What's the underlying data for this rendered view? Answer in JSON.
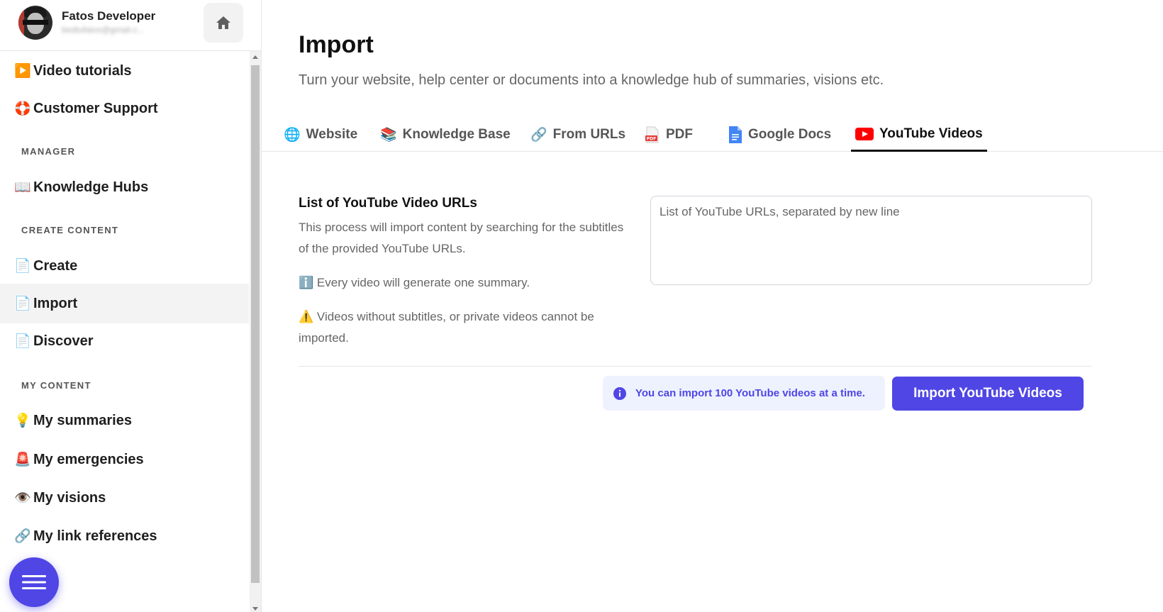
{
  "user": {
    "name": "Fatos Developer",
    "email": "bedtufatos@gmail.c..."
  },
  "icons": {
    "home": "home-icon",
    "menu": "menu-icon",
    "info": "info-icon"
  },
  "sidebar": {
    "items": [
      {
        "label": "Video tutorials",
        "icon": "▶️"
      },
      {
        "label": "Customer Support",
        "icon": "🛟"
      }
    ],
    "sections": [
      {
        "title": "MANAGER",
        "items": [
          {
            "label": "Knowledge Hubs",
            "icon": "📖"
          }
        ]
      },
      {
        "title": "CREATE CONTENT",
        "items": [
          {
            "label": "Create",
            "icon": "📄"
          },
          {
            "label": "Import",
            "icon": "📄",
            "active": true
          },
          {
            "label": "Discover",
            "icon": "📄"
          }
        ]
      },
      {
        "title": "MY CONTENT",
        "items": [
          {
            "label": "My summaries",
            "icon": "💡"
          },
          {
            "label": "My emergencies",
            "icon": "🚨"
          },
          {
            "label": "My visions",
            "icon": "👁️"
          },
          {
            "label": "My link references",
            "icon": "🔗"
          }
        ]
      }
    ]
  },
  "main": {
    "title": "Import",
    "subtitle": "Turn your website, help center or documents into a knowledge hub of summaries, visions etc.",
    "tabs": [
      {
        "label": "Website",
        "icon": "🌐"
      },
      {
        "label": "Knowledge Base",
        "icon": "📚"
      },
      {
        "label": "From URLs",
        "icon": "🔗"
      },
      {
        "label": "PDF",
        "icon": "pdf"
      },
      {
        "label": "Google Docs",
        "icon": "gdoc"
      },
      {
        "label": "YouTube Videos",
        "icon": "youtube",
        "active": true
      }
    ],
    "form": {
      "label": "List of YouTube Video URLs",
      "description": "This process will import content by searching for the subtitles of the provided YouTube URLs.",
      "note_info_icon": "ℹ️",
      "note_info": "Every video will generate one summary.",
      "note_warning_icon": "⚠️",
      "note_warning": "Videos without subtitles, or private videos cannot be imported.",
      "placeholder": "List of YouTube URLs, separated by new line"
    },
    "info_message": "You can import 100 YouTube videos at a time.",
    "import_button": "Import YouTube Videos"
  },
  "colors": {
    "accent": "#4f46e5",
    "info_bg": "#eef2ff",
    "youtube_red": "#ff0000"
  }
}
